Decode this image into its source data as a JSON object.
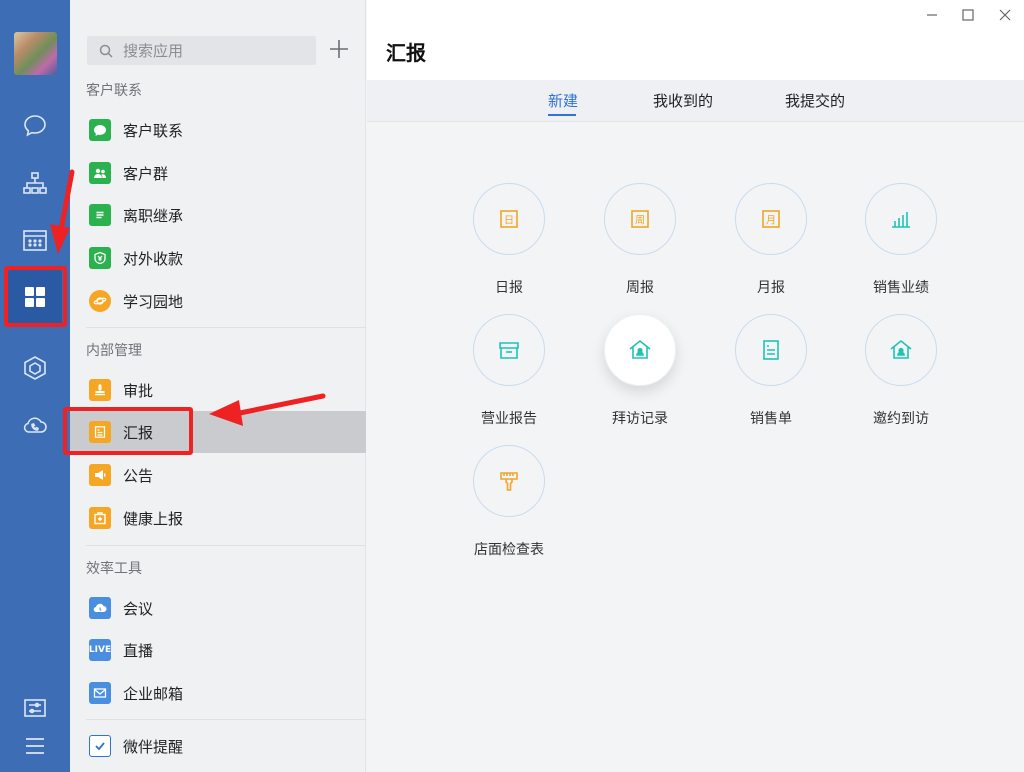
{
  "search": {
    "placeholder": "搜索应用"
  },
  "sections": [
    {
      "title": "客户联系",
      "items": [
        "客户联系",
        "客户群",
        "离职继承",
        "对外收款",
        "学习园地"
      ]
    },
    {
      "title": "内部管理",
      "items": [
        "审批",
        "汇报",
        "公告",
        "健康上报"
      ]
    },
    {
      "title": "效率工具",
      "items": [
        "会议",
        "直播",
        "企业邮箱"
      ]
    },
    {
      "title": "",
      "items": [
        "微伴提醒"
      ]
    }
  ],
  "icons": {
    "live_badge": "LIVE"
  },
  "page": {
    "title": "汇报"
  },
  "tabs": [
    "新建",
    "我收到的",
    "我提交的"
  ],
  "tiles": [
    {
      "label": "日报",
      "glyph": "日",
      "color": "#f0a626"
    },
    {
      "label": "周报",
      "glyph": "周",
      "color": "#f0a626"
    },
    {
      "label": "月报",
      "glyph": "月",
      "color": "#f0a626"
    },
    {
      "label": "销售业绩",
      "color": "#1ec3b5"
    },
    {
      "label": "营业报告",
      "color": "#1ec3b5"
    },
    {
      "label": "拜访记录",
      "color": "#1ec3b5"
    },
    {
      "label": "销售单",
      "color": "#1ec3b5"
    },
    {
      "label": "邀约到访",
      "color": "#1ec3b5"
    },
    {
      "label": "店面检查表",
      "color": "#f0a626"
    }
  ],
  "colors": {
    "rail": "#3d6db5",
    "accent": "#2f73d9",
    "highlight": "#ee2222",
    "green": "#2bb14d",
    "orange": "#f5a623",
    "blue": "#4a8ee0"
  }
}
